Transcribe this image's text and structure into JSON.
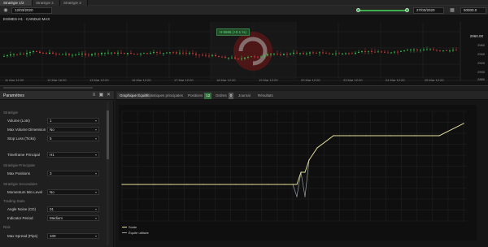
{
  "tabs": [
    {
      "label": "Stratégie 1/2"
    },
    {
      "label": "Stratégie 2"
    },
    {
      "label": "Stratégie 3"
    }
  ],
  "toolbar": {
    "date_from": "12/03/2020",
    "date_to": "27/03/2020",
    "speed": "50000.0",
    "progress": 0.4
  },
  "candle_chart": {
    "title": "ES/MES H1 · CANDLE MAX",
    "price_box": "H:5566 (+0.1 %)",
    "price_current": "2960.00",
    "price_ticks": [
      "2960",
      "2940",
      "2920",
      "2900",
      "2880"
    ],
    "dates": [
      "11 Mar 12:00",
      "12 Mar 16:00",
      "13 Mar 12:00",
      "16 Mar 12:00",
      "17 Mar 12:00",
      "18 Mar 12:00",
      "19 Mar 12:00",
      "20 Mar 12:00",
      "23 Mar 12:00",
      "24 Mar 12:00",
      "25 Mar 12:00"
    ]
  },
  "left_panel": {
    "title": "Paramètres",
    "sections": [
      {
        "title": "Stratégie",
        "rows": [
          {
            "label": "Volume (Lots)",
            "value": "1"
          },
          {
            "label": "Max Volume Dimension",
            "value": "No"
          },
          {
            "label": "Stop Loss (Ticks)",
            "value": "5"
          },
          {
            "label": "Timeframe Principal",
            "value": "H1"
          }
        ]
      },
      {
        "title": "Stratégie Principale",
        "rows": [
          {
            "label": "Max Positions",
            "value": "3"
          }
        ]
      },
      {
        "title": "Stratégie Secondaire",
        "rows": [
          {
            "label": "Momentum Min Level",
            "value": "No"
          }
        ]
      },
      {
        "title": "Trading Stats",
        "rows": [
          {
            "label": "Angle Noise (CD)",
            "value": "01"
          },
          {
            "label": "Indicator Period",
            "value": "Medium"
          }
        ]
      },
      {
        "title": "Risk",
        "rows": [
          {
            "label": "Max Spread (Pips)",
            "value": "100"
          }
        ]
      }
    ]
  },
  "main_panel": {
    "tabs": [
      {
        "label": "Graphique Équité"
      },
      {
        "label": "Statistiques principales"
      },
      {
        "label": "Positions",
        "badge": "12"
      },
      {
        "label": "Ordres",
        "badge": "0"
      },
      {
        "label": "Journal"
      },
      {
        "label": "Résultats"
      }
    ],
    "legend": [
      {
        "label": "Solde",
        "color": "#e7e39a"
      },
      {
        "label": "Équité utilisée",
        "color": "#9aa0a6"
      }
    ]
  },
  "chart_data": {
    "type": "line",
    "title": "",
    "xlabel": "",
    "ylabel": "",
    "x": [
      0,
      20,
      40,
      60,
      80,
      100,
      120,
      140,
      160,
      180,
      200,
      210,
      215,
      220,
      225,
      230,
      240,
      260,
      280,
      300,
      330,
      360,
      390,
      420
    ],
    "series": [
      {
        "name": "Solde",
        "values": [
          0,
          0,
          0,
          0,
          0,
          0,
          0,
          0,
          0,
          0,
          0,
          0,
          0,
          1,
          1,
          2,
          3,
          4,
          4,
          4,
          4,
          4,
          4,
          5
        ]
      },
      {
        "name": "Équité utilisée",
        "values": [
          0,
          0,
          0,
          0,
          0,
          0,
          0,
          0,
          0,
          0,
          0,
          0,
          -1,
          1,
          -1,
          2,
          3,
          4,
          4,
          4,
          4,
          4,
          4,
          5
        ]
      }
    ],
    "grid": true,
    "legend_position": "bottom-left"
  }
}
